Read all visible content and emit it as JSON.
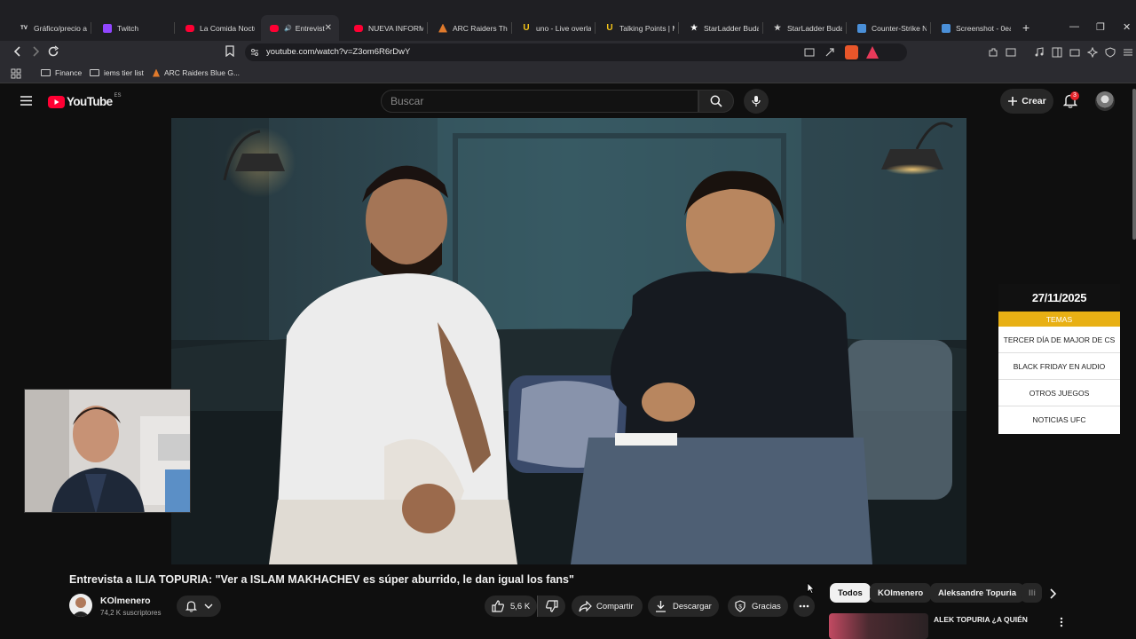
{
  "browser": {
    "tabs": [
      {
        "title": "Gráfico/precio ac",
        "icon": "tradingview-icon",
        "color": "#ffffff"
      },
      {
        "title": "Twitch",
        "icon": "twitch-icon",
        "color": "#9146ff"
      },
      {
        "title": "La Comida Noctu",
        "icon": "youtube-icon",
        "color": "#ff0033"
      },
      {
        "title": "Entrevista",
        "icon": "youtube-icon",
        "color": "#ff0033",
        "active": true
      },
      {
        "title": "NUEVA INFORMA",
        "icon": "youtube-icon",
        "color": "#ff0033"
      },
      {
        "title": "ARC Raiders The",
        "icon": "arc-raiders-icon",
        "color": "#e07a2c"
      },
      {
        "title": "uno - Live overlay",
        "icon": "uno-icon",
        "color": "#f5c518"
      },
      {
        "title": "Talking Points | M",
        "icon": "u-logo-icon",
        "color": "#f5c518"
      },
      {
        "title": "StarLadder Budap",
        "icon": "starladder-icon",
        "color": "#ffffff"
      },
      {
        "title": "StarLadder Budap",
        "icon": "starladder-icon",
        "color": "#cccccc"
      },
      {
        "title": "Counter-Strike Ne",
        "icon": "counter-strike-icon",
        "color": "#4a8fd8"
      },
      {
        "title": "Screenshot - 0ea",
        "icon": "screenshot-icon",
        "color": "#4a8fd8"
      }
    ],
    "url": "youtube.com/watch?v=Z3om6R6rDwY",
    "shield_badge": "",
    "bookmarks": [
      {
        "label": "Finance",
        "icon": "folder-icon"
      },
      {
        "label": "iems tier list",
        "icon": "folder-icon"
      },
      {
        "label": "ARC Raiders Blue G...",
        "icon": "arc-raiders-icon"
      }
    ]
  },
  "youtube": {
    "logo_text": "YouTube",
    "region": "ES",
    "search_placeholder": "Buscar",
    "create_label": "Crear",
    "notification_count": "3",
    "accent": "#ff0033"
  },
  "overlay": {
    "date": "27/11/2025",
    "header": "TEMAS",
    "topics": [
      "TERCER DÍA DE MAJOR DE CS",
      "BLACK FRIDAY EN AUDIO",
      "OTROS JUEGOS",
      "NOTICIAS UFC"
    ],
    "accent": "#e8b014"
  },
  "video": {
    "title": "Entrevista a ILIA TOPURIA: \"Ver a ISLAM MAKHACHEV es súper aburrido, le dan igual los fans\"",
    "channel": "KOlmenero",
    "subscribers": "74,2 K suscriptores",
    "likes": "5,6 K",
    "share_label": "Compartir",
    "download_label": "Descargar",
    "thanks_label": "Gracias"
  },
  "recommendations": {
    "chips": [
      "Todos",
      "KOlmenero",
      "Aleksandre Topuria",
      "Ili"
    ],
    "first_title": "ALEK TOPURIA ¿A QUIÉN"
  }
}
